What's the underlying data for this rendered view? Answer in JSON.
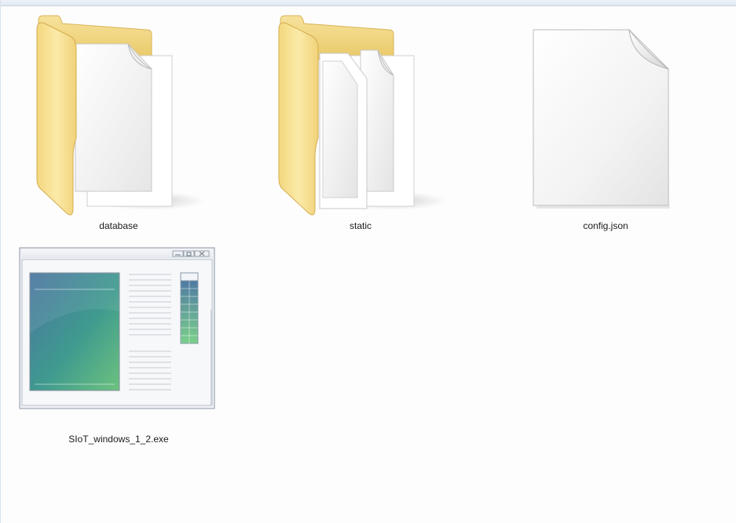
{
  "items": [
    {
      "name": "database",
      "type": "folder",
      "icon": "folder-with-document-icon"
    },
    {
      "name": "static",
      "type": "folder",
      "icon": "folder-with-documents-icon"
    },
    {
      "name": "config.json",
      "type": "file",
      "icon": "blank-document-icon"
    },
    {
      "name": "SIoT_windows_1_2.exe",
      "type": "application",
      "icon": "application-window-icon"
    }
  ],
  "colors": {
    "folder_tab": "#f3d98c",
    "folder_front": "#f7e39a",
    "page": "#f6f6f6",
    "app_gradient_start": "#4a7fa0",
    "app_gradient_end": "#6cc27e"
  }
}
